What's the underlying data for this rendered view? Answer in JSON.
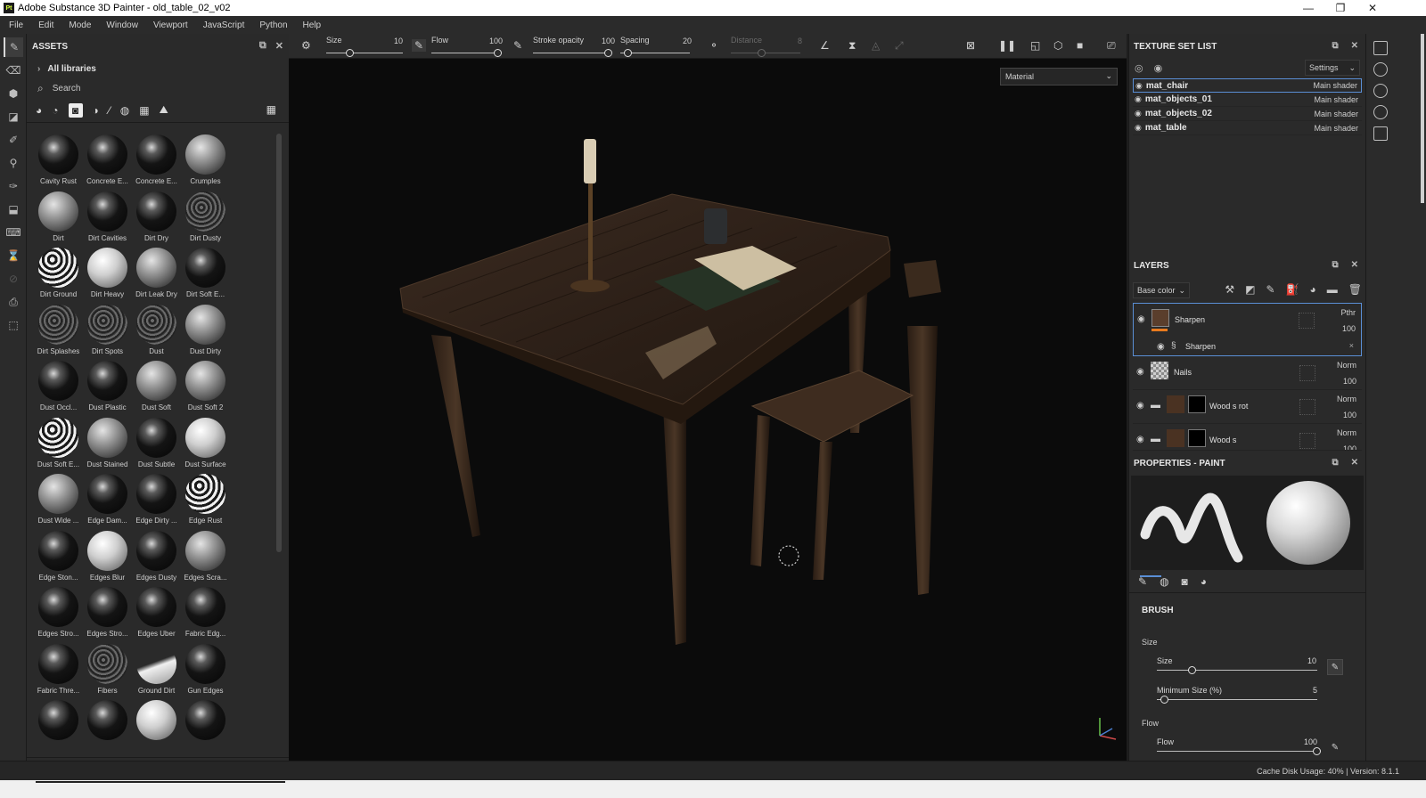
{
  "window": {
    "title": "Adobe Substance 3D Painter - old_table_02_v02",
    "app_icon_text": "Pt"
  },
  "menu": [
    "File",
    "Edit",
    "Mode",
    "Window",
    "Viewport",
    "JavaScript",
    "Python",
    "Help"
  ],
  "assets": {
    "title": "ASSETS",
    "library": "All libraries",
    "search_placeholder": "Search",
    "items": [
      {
        "label": "Cavity Rust",
        "tone": "dark"
      },
      {
        "label": "Concrete E...",
        "tone": "dark"
      },
      {
        "label": "Concrete E...",
        "tone": "dark"
      },
      {
        "label": "Crumples",
        "tone": "grey"
      },
      {
        "label": "Dirt",
        "tone": "grey"
      },
      {
        "label": "Dirt Cavities",
        "tone": "dark"
      },
      {
        "label": "Dirt Dry",
        "tone": "dark"
      },
      {
        "label": "Dirt Dusty",
        "tone": "noisy"
      },
      {
        "label": "Dirt Ground",
        "tone": "ring"
      },
      {
        "label": "Dirt Heavy",
        "tone": "light"
      },
      {
        "label": "Dirt Leak Dry",
        "tone": "grey"
      },
      {
        "label": "Dirt Soft E...",
        "tone": "dark"
      },
      {
        "label": "Dirt Splashes",
        "tone": "noisy"
      },
      {
        "label": "Dirt Spots",
        "tone": "noisy"
      },
      {
        "label": "Dust",
        "tone": "noisy"
      },
      {
        "label": "Dust Dirty",
        "tone": "grey"
      },
      {
        "label": "Dust Occl...",
        "tone": "dark"
      },
      {
        "label": "Dust Plastic",
        "tone": "dark"
      },
      {
        "label": "Dust Soft",
        "tone": "grey"
      },
      {
        "label": "Dust Soft 2",
        "tone": "grey"
      },
      {
        "label": "Dust Soft E...",
        "tone": "ring"
      },
      {
        "label": "Dust Stained",
        "tone": "grey"
      },
      {
        "label": "Dust Subtle",
        "tone": "dark"
      },
      {
        "label": "Dust Surface",
        "tone": "light"
      },
      {
        "label": "Dust Wide ...",
        "tone": "grey"
      },
      {
        "label": "Edge Dam...",
        "tone": "dark"
      },
      {
        "label": "Edge Dirty ...",
        "tone": "dark"
      },
      {
        "label": "Edge Rust",
        "tone": "ring"
      },
      {
        "label": "Edge Ston...",
        "tone": "dark"
      },
      {
        "label": "Edges Blur",
        "tone": "light"
      },
      {
        "label": "Edges Dusty",
        "tone": "dark"
      },
      {
        "label": "Edges Scra...",
        "tone": "grey"
      },
      {
        "label": "Edges Stro...",
        "tone": "dark"
      },
      {
        "label": "Edges Stro...",
        "tone": "dark"
      },
      {
        "label": "Edges Uber",
        "tone": "dark"
      },
      {
        "label": "Fabric Edg...",
        "tone": "dark"
      },
      {
        "label": "Fabric Thre...",
        "tone": "dark"
      },
      {
        "label": "Fibers",
        "tone": "noisy"
      },
      {
        "label": "Ground Dirt",
        "tone": "half"
      },
      {
        "label": "Gun Edges",
        "tone": "dark"
      },
      {
        "label": "",
        "tone": "dark"
      },
      {
        "label": "",
        "tone": "dark"
      },
      {
        "label": "",
        "tone": "light"
      },
      {
        "label": "",
        "tone": "dark"
      }
    ]
  },
  "toolbar": {
    "size_label": "Size",
    "size_value": "10",
    "flow_label": "Flow",
    "flow_value": "100",
    "stroke_opacity_label": "Stroke opacity",
    "stroke_opacity_value": "100",
    "spacing_label": "Spacing",
    "spacing_value": "20",
    "distance_label": "Distance",
    "distance_value": "8"
  },
  "viewport": {
    "material_mode": "Material"
  },
  "texture_set_list": {
    "title": "TEXTURE SET LIST",
    "settings_label": "Settings",
    "sets": [
      {
        "name": "mat_chair",
        "shader": "Main shader",
        "active": true
      },
      {
        "name": "mat_objects_01",
        "shader": "Main shader",
        "active": false
      },
      {
        "name": "mat_objects_02",
        "shader": "Main shader",
        "active": false
      },
      {
        "name": "mat_table",
        "shader": "Main shader",
        "active": false
      }
    ]
  },
  "layers": {
    "title": "LAYERS",
    "channel": "Base color",
    "items": [
      {
        "name": "Sharpen",
        "blend": "Pthr",
        "opacity": "100",
        "sub_effect": "Sharpen"
      },
      {
        "name": "Nails",
        "blend": "Norm",
        "opacity": "100"
      },
      {
        "name": "Wood s rot",
        "blend": "Norm",
        "opacity": "100"
      },
      {
        "name": "Wood s",
        "blend": "Norm",
        "opacity": "100"
      }
    ]
  },
  "properties": {
    "title": "PROPERTIES - PAINT",
    "section": "BRUSH",
    "size_group": "Size",
    "size_label": "Size",
    "size_value": "10",
    "size_fraction": 0.22,
    "min_size_label": "Minimum Size (%)",
    "min_size_value": "5",
    "min_size_fraction": 0.05,
    "flow_group": "Flow",
    "flow_label": "Flow",
    "flow_value": "100",
    "flow_fraction": 1.0
  },
  "status": {
    "cache": "Cache Disk Usage:   40% | Version: 8.1.1"
  },
  "colors": {
    "accent": "#5a8fd6",
    "layer_marker": "#e87a1e",
    "viewport_bg": "#0b0b0b"
  }
}
